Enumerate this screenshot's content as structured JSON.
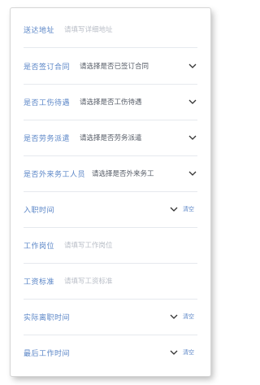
{
  "form": {
    "address": {
      "label": "送达地址",
      "placeholder": "请填写详细地址"
    },
    "sign_contract": {
      "label": "是否签订合同",
      "value": "请选择是否已签订合同"
    },
    "work_benefits": {
      "label": "是否工伤待遇",
      "value": "请选择是否工伤待遇"
    },
    "labor_dispatch": {
      "label": "是否劳务派遣",
      "value": "请选择是否劳务派遣"
    },
    "foreign_worker": {
      "label": "是否外来务工人员",
      "value": "请选择是否外来务工"
    },
    "entry_time": {
      "label": "入职时间",
      "clear": "清空"
    },
    "position": {
      "label": "工作岗位",
      "placeholder": "请填写工作岗位"
    },
    "wage_standard": {
      "label": "工资标准",
      "placeholder": "请填写工资标准"
    },
    "leave_time": {
      "label": "实际离职时间",
      "clear": "清空"
    },
    "last_work_time": {
      "label": "最后工作时间",
      "clear": "清空"
    }
  }
}
